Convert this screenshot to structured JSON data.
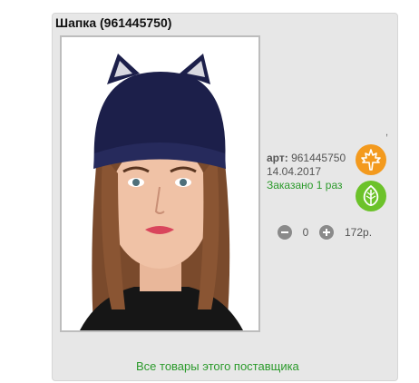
{
  "product": {
    "title": "Шапка (961445750)",
    "art_label": "арт:",
    "art_number": "961445750",
    "date": "14.04.2017",
    "ordered": "Заказано 1 раз",
    "quantity": "0",
    "price": "172р.",
    "all_goods_link": "Все товары этого поставщика"
  },
  "badges": [
    {
      "icon": "maple-leaf-icon",
      "color": "#f39a1e"
    },
    {
      "icon": "leaf-icon",
      "color": "#6cc22a"
    }
  ],
  "colors": {
    "card_bg": "#e7e7e7",
    "link_green": "#2b9a2b",
    "hat_navy": "#1c1f4a"
  }
}
